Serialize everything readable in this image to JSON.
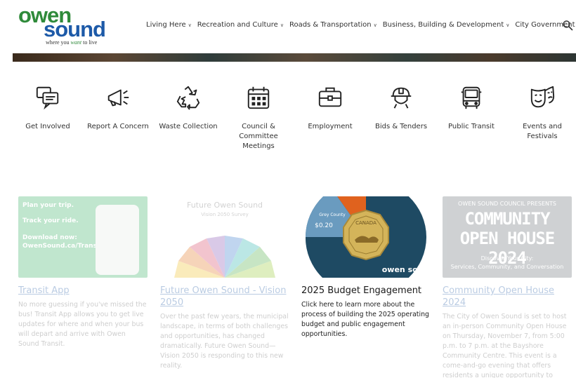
{
  "logo": {
    "word1": "owen",
    "word2": "sound",
    "tagline_pre": "where you ",
    "tagline_em": "want",
    "tagline_post": " to live"
  },
  "nav": {
    "items": [
      {
        "label": "Living Here"
      },
      {
        "label": "Recreation and Culture"
      },
      {
        "label": "Roads & Transportation"
      },
      {
        "label": "Business, Building & Development"
      },
      {
        "label": "City Government"
      }
    ]
  },
  "quick_links": [
    {
      "label": "Get Involved",
      "icon": "chat-icon"
    },
    {
      "label": "Report A Concern",
      "icon": "megaphone-icon"
    },
    {
      "label": "Waste Collection",
      "icon": "recycle-icon"
    },
    {
      "label": "Council & Committee Meetings",
      "icon": "calendar-icon"
    },
    {
      "label": "Employment",
      "icon": "briefcase-icon"
    },
    {
      "label": "Bids & Tenders",
      "icon": "hardhat-icon"
    },
    {
      "label": "Public Transit",
      "icon": "bus-icon"
    },
    {
      "label": "Events and Festivals",
      "icon": "theatre-masks-icon"
    }
  ],
  "cards": [
    {
      "title": "Transit App",
      "desc": "No more guessing if you've missed the bus! Transit App allows you to get live updates for where and when your bus will depart and arrive with Owen Sound Transit.",
      "img_lines": [
        "Plan your trip.",
        "Track your ride.",
        "Download now:",
        "OwenSound.ca/Transit"
      ]
    },
    {
      "title": "Future Owen Sound - Vision 2050",
      "desc": "Over the past few years, the municipal landscape, in terms of both challenges and opportunities, has changed dramatically. Future Owen Sound—Vision 2050 is responding to this new reality.",
      "img_title": "Future Owen Sound",
      "img_sub": "Vision 2050 Survey"
    },
    {
      "title": "2025 Budget Engagement",
      "desc": "Click here to learn more about the process of building the 2025 operating budget and public engagement opportunities.",
      "img_amount": "$0.20",
      "img_county": "Grey County",
      "img_coin": "CANADA",
      "img_brand": "owen sound"
    },
    {
      "title": "Community Open House 2024",
      "desc": "The City of Owen Sound is set to host an in-person Community Open House on Thursday, November 7, from 5:00 p.m. to 7 p.m. at the Bayshore Community Centre. This event is a come-and-go evening that offers residents a unique opportunity to engage directly with city",
      "img_top": "OWEN SOUND COUNCIL PRESENTS",
      "img_line1": "COMMUNITY",
      "img_line2": "OPEN HOUSE 2024",
      "img_sub1": "Discover Your City:",
      "img_sub2": "Services, Community, and Conversation"
    }
  ],
  "colors": {
    "green": "#2f8a3a",
    "blue": "#1d5aa8",
    "budget_navy": "#1e4a63",
    "budget_orange": "#e0621e",
    "budget_light": "#6a9bbf"
  }
}
